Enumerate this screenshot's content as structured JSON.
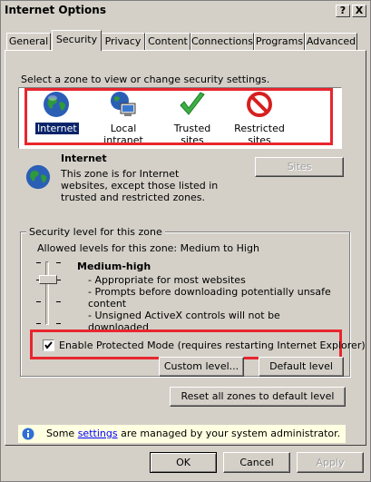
{
  "window": {
    "title": "Internet Options",
    "help_button": "?",
    "close_button": "X"
  },
  "tabs": [
    {
      "label": "General",
      "active": false
    },
    {
      "label": "Security",
      "active": true
    },
    {
      "label": "Privacy",
      "active": false
    },
    {
      "label": "Content",
      "active": false
    },
    {
      "label": "Connections",
      "active": false
    },
    {
      "label": "Programs",
      "active": false
    },
    {
      "label": "Advanced",
      "active": false
    }
  ],
  "security": {
    "prompt": "Select a zone to view or change security settings.",
    "zones": [
      {
        "label": "Internet",
        "icon": "globe-icon",
        "selected": true
      },
      {
        "label": "Local intranet",
        "icon": "intranet-icon",
        "selected": false
      },
      {
        "label": "Trusted sites",
        "icon": "checkmark-icon",
        "selected": false
      },
      {
        "label": "Restricted sites",
        "icon": "prohibited-icon",
        "selected": false
      }
    ],
    "zone_title": "Internet",
    "zone_description": "This zone is for Internet websites, except those listed in trusted and restricted zones.",
    "sites_button": "Sites",
    "level_group_label": "Security level for this zone",
    "allowed_levels": "Allowed levels for this zone: Medium to High",
    "level_name": "Medium-high",
    "level_bullets": [
      "- Appropriate for most websites",
      "- Prompts before downloading potentially unsafe content",
      "- Unsigned ActiveX controls will not be downloaded"
    ],
    "protected_mode_label": "Enable Protected Mode (requires restarting Internet Explorer)",
    "protected_mode_checked": true,
    "custom_level_button": "Custom level...",
    "default_level_button": "Default level",
    "reset_all_button": "Reset all zones to default level",
    "info_prefix": "Some ",
    "info_link": "settings",
    "info_suffix": " are managed by your system administrator."
  },
  "footer": {
    "ok": "OK",
    "cancel": "Cancel",
    "apply": "Apply"
  },
  "colors": {
    "highlight_box": "#e8262e",
    "selection": "#0a246a",
    "info_bar": "#ffffe1"
  }
}
